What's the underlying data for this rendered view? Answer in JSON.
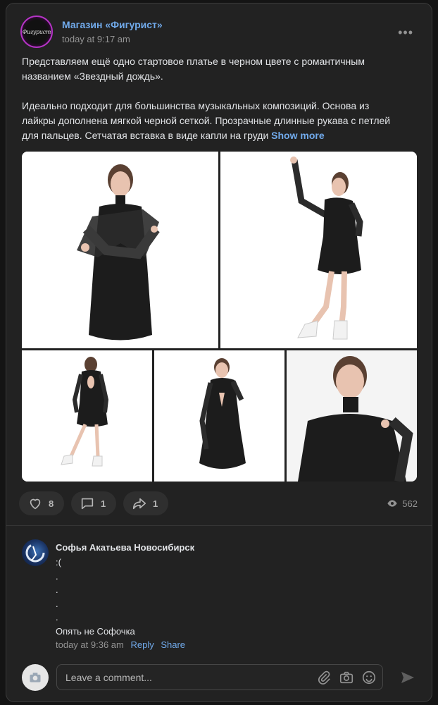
{
  "post": {
    "author": "Магазин «Фигурист»",
    "time": "today at 9:17 am",
    "avatar_text": "Фигурист",
    "menu_icon": "more-horizontal-icon",
    "text_line1": "Представляем ещё одно стартовое платье в черном цвете с романтичным",
    "text_line2": "названием «Звездный дождь».",
    "text_line3": "Идеально подходит для большинства музыкальных композиций. Основа из",
    "text_line4": "лайкры дополнена мягкой черной сеткой. Прозрачные длинные рукава с петлей",
    "text_line5": "для пальцев. Сетчатая вставка в виде капли на груди",
    "show_more": "Show more",
    "photos": [
      "photo-1",
      "photo-2",
      "photo-3",
      "photo-4",
      "photo-5"
    ]
  },
  "actions": {
    "likes": "8",
    "comments": "1",
    "shares": "1",
    "views": "562"
  },
  "comment": {
    "author": "Софья Акатьева Новосибирск",
    "lines": [
      ":(",
      ".",
      ".",
      ".",
      ".",
      "Опять не Софочка"
    ],
    "time": "today at 9:36 am",
    "reply": "Reply",
    "share": "Share"
  },
  "composer": {
    "placeholder": "Leave a comment..."
  },
  "colors": {
    "accent": "#71aaeb",
    "background": "#222222",
    "muted": "#939393"
  }
}
